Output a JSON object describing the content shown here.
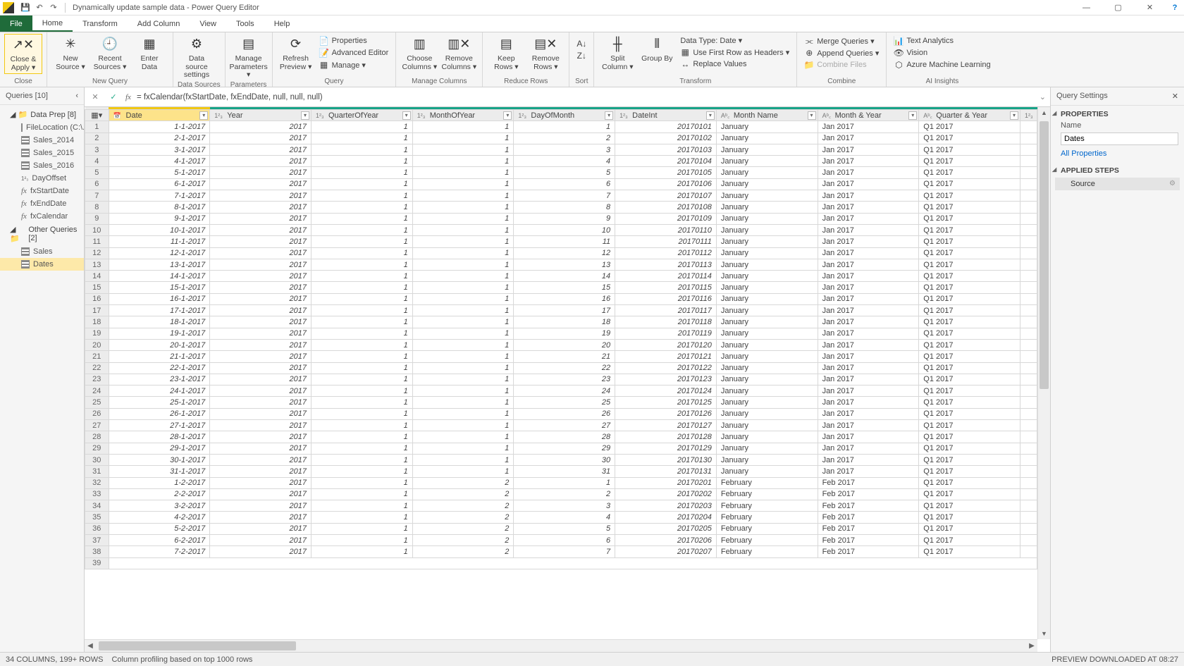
{
  "titlebar": {
    "title": "Dynamically update sample data - Power Query Editor"
  },
  "tabs": {
    "file": "File",
    "home": "Home",
    "transform": "Transform",
    "addcolumn": "Add Column",
    "view": "View",
    "tools": "Tools",
    "help": "Help"
  },
  "ribbon": {
    "close_apply": "Close &\nApply ▾",
    "new_source": "New\nSource ▾",
    "recent_sources": "Recent\nSources ▾",
    "enter_data": "Enter\nData",
    "data_source_settings": "Data source\nsettings",
    "manage_parameters": "Manage\nParameters ▾",
    "refresh_preview": "Refresh\nPreview ▾",
    "properties": "Properties",
    "advanced_editor": "Advanced Editor",
    "manage": "Manage ▾",
    "choose_columns": "Choose\nColumns ▾",
    "remove_columns": "Remove\nColumns ▾",
    "keep_rows": "Keep\nRows ▾",
    "remove_rows": "Remove\nRows ▾",
    "sort": "",
    "split_column": "Split\nColumn ▾",
    "group_by": "Group\nBy",
    "data_type": "Data Type: Date ▾",
    "first_row_headers": "Use First Row as Headers ▾",
    "replace_values": "Replace Values",
    "merge_queries": "Merge Queries ▾",
    "append_queries": "Append Queries ▾",
    "combine_files": "Combine Files",
    "text_analytics": "Text Analytics",
    "vision": "Vision",
    "azure_ml": "Azure Machine Learning",
    "grp_close": "Close",
    "grp_newquery": "New Query",
    "grp_datasources": "Data Sources",
    "grp_parameters": "Parameters",
    "grp_query": "Query",
    "grp_managecols": "Manage Columns",
    "grp_reducerows": "Reduce Rows",
    "grp_sort": "Sort",
    "grp_transform": "Transform",
    "grp_combine": "Combine",
    "grp_ai": "AI Insights"
  },
  "queries": {
    "header": "Queries [10]",
    "group1": "Data Prep [8]",
    "group2": "Other Queries [2]",
    "items1": [
      "FileLocation (C:\\...",
      "Sales_2014",
      "Sales_2015",
      "Sales_2016",
      "DayOffset",
      "fxStartDate",
      "fxEndDate",
      "fxCalendar"
    ],
    "items2": [
      "Sales",
      "Dates"
    ]
  },
  "formula": "= fxCalendar(fxStartDate, fxEndDate, null, null, null)",
  "columns": [
    "Date",
    "Year",
    "QuarterOfYear",
    "MonthOfYear",
    "DayOfMonth",
    "DateInt",
    "Month Name",
    "Month & Year",
    "Quarter & Year"
  ],
  "col_types": [
    "📅",
    "1²₃",
    "1²₃",
    "1²₃",
    "1²₃",
    "1²₃",
    "Aᵇ꜀",
    "Aᵇ꜀",
    "Aᵇ꜀"
  ],
  "rows": [
    [
      "1-1-2017",
      "2017",
      "1",
      "1",
      "1",
      "20170101",
      "January",
      "Jan 2017",
      "Q1 2017"
    ],
    [
      "2-1-2017",
      "2017",
      "1",
      "1",
      "2",
      "20170102",
      "January",
      "Jan 2017",
      "Q1 2017"
    ],
    [
      "3-1-2017",
      "2017",
      "1",
      "1",
      "3",
      "20170103",
      "January",
      "Jan 2017",
      "Q1 2017"
    ],
    [
      "4-1-2017",
      "2017",
      "1",
      "1",
      "4",
      "20170104",
      "January",
      "Jan 2017",
      "Q1 2017"
    ],
    [
      "5-1-2017",
      "2017",
      "1",
      "1",
      "5",
      "20170105",
      "January",
      "Jan 2017",
      "Q1 2017"
    ],
    [
      "6-1-2017",
      "2017",
      "1",
      "1",
      "6",
      "20170106",
      "January",
      "Jan 2017",
      "Q1 2017"
    ],
    [
      "7-1-2017",
      "2017",
      "1",
      "1",
      "7",
      "20170107",
      "January",
      "Jan 2017",
      "Q1 2017"
    ],
    [
      "8-1-2017",
      "2017",
      "1",
      "1",
      "8",
      "20170108",
      "January",
      "Jan 2017",
      "Q1 2017"
    ],
    [
      "9-1-2017",
      "2017",
      "1",
      "1",
      "9",
      "20170109",
      "January",
      "Jan 2017",
      "Q1 2017"
    ],
    [
      "10-1-2017",
      "2017",
      "1",
      "1",
      "10",
      "20170110",
      "January",
      "Jan 2017",
      "Q1 2017"
    ],
    [
      "11-1-2017",
      "2017",
      "1",
      "1",
      "11",
      "20170111",
      "January",
      "Jan 2017",
      "Q1 2017"
    ],
    [
      "12-1-2017",
      "2017",
      "1",
      "1",
      "12",
      "20170112",
      "January",
      "Jan 2017",
      "Q1 2017"
    ],
    [
      "13-1-2017",
      "2017",
      "1",
      "1",
      "13",
      "20170113",
      "January",
      "Jan 2017",
      "Q1 2017"
    ],
    [
      "14-1-2017",
      "2017",
      "1",
      "1",
      "14",
      "20170114",
      "January",
      "Jan 2017",
      "Q1 2017"
    ],
    [
      "15-1-2017",
      "2017",
      "1",
      "1",
      "15",
      "20170115",
      "January",
      "Jan 2017",
      "Q1 2017"
    ],
    [
      "16-1-2017",
      "2017",
      "1",
      "1",
      "16",
      "20170116",
      "January",
      "Jan 2017",
      "Q1 2017"
    ],
    [
      "17-1-2017",
      "2017",
      "1",
      "1",
      "17",
      "20170117",
      "January",
      "Jan 2017",
      "Q1 2017"
    ],
    [
      "18-1-2017",
      "2017",
      "1",
      "1",
      "18",
      "20170118",
      "January",
      "Jan 2017",
      "Q1 2017"
    ],
    [
      "19-1-2017",
      "2017",
      "1",
      "1",
      "19",
      "20170119",
      "January",
      "Jan 2017",
      "Q1 2017"
    ],
    [
      "20-1-2017",
      "2017",
      "1",
      "1",
      "20",
      "20170120",
      "January",
      "Jan 2017",
      "Q1 2017"
    ],
    [
      "21-1-2017",
      "2017",
      "1",
      "1",
      "21",
      "20170121",
      "January",
      "Jan 2017",
      "Q1 2017"
    ],
    [
      "22-1-2017",
      "2017",
      "1",
      "1",
      "22",
      "20170122",
      "January",
      "Jan 2017",
      "Q1 2017"
    ],
    [
      "23-1-2017",
      "2017",
      "1",
      "1",
      "23",
      "20170123",
      "January",
      "Jan 2017",
      "Q1 2017"
    ],
    [
      "24-1-2017",
      "2017",
      "1",
      "1",
      "24",
      "20170124",
      "January",
      "Jan 2017",
      "Q1 2017"
    ],
    [
      "25-1-2017",
      "2017",
      "1",
      "1",
      "25",
      "20170125",
      "January",
      "Jan 2017",
      "Q1 2017"
    ],
    [
      "26-1-2017",
      "2017",
      "1",
      "1",
      "26",
      "20170126",
      "January",
      "Jan 2017",
      "Q1 2017"
    ],
    [
      "27-1-2017",
      "2017",
      "1",
      "1",
      "27",
      "20170127",
      "January",
      "Jan 2017",
      "Q1 2017"
    ],
    [
      "28-1-2017",
      "2017",
      "1",
      "1",
      "28",
      "20170128",
      "January",
      "Jan 2017",
      "Q1 2017"
    ],
    [
      "29-1-2017",
      "2017",
      "1",
      "1",
      "29",
      "20170129",
      "January",
      "Jan 2017",
      "Q1 2017"
    ],
    [
      "30-1-2017",
      "2017",
      "1",
      "1",
      "30",
      "20170130",
      "January",
      "Jan 2017",
      "Q1 2017"
    ],
    [
      "31-1-2017",
      "2017",
      "1",
      "1",
      "31",
      "20170131",
      "January",
      "Jan 2017",
      "Q1 2017"
    ],
    [
      "1-2-2017",
      "2017",
      "1",
      "2",
      "1",
      "20170201",
      "February",
      "Feb 2017",
      "Q1 2017"
    ],
    [
      "2-2-2017",
      "2017",
      "1",
      "2",
      "2",
      "20170202",
      "February",
      "Feb 2017",
      "Q1 2017"
    ],
    [
      "3-2-2017",
      "2017",
      "1",
      "2",
      "3",
      "20170203",
      "February",
      "Feb 2017",
      "Q1 2017"
    ],
    [
      "4-2-2017",
      "2017",
      "1",
      "2",
      "4",
      "20170204",
      "February",
      "Feb 2017",
      "Q1 2017"
    ],
    [
      "5-2-2017",
      "2017",
      "1",
      "2",
      "5",
      "20170205",
      "February",
      "Feb 2017",
      "Q1 2017"
    ],
    [
      "6-2-2017",
      "2017",
      "1",
      "2",
      "6",
      "20170206",
      "February",
      "Feb 2017",
      "Q1 2017"
    ],
    [
      "7-2-2017",
      "2017",
      "1",
      "2",
      "7",
      "20170207",
      "February",
      "Feb 2017",
      "Q1 2017"
    ]
  ],
  "col_align": [
    "num",
    "num",
    "num",
    "num",
    "num",
    "num",
    "txt",
    "txt",
    "txt"
  ],
  "settings": {
    "header": "Query Settings",
    "properties": "PROPERTIES",
    "name_label": "Name",
    "name_value": "Dates",
    "all_properties": "All Properties",
    "applied_steps": "APPLIED STEPS",
    "step1": "Source"
  },
  "status": {
    "left1": "34 COLUMNS, 199+ ROWS",
    "left2": "Column profiling based on top 1000 rows",
    "right": "PREVIEW DOWNLOADED AT 08:27"
  }
}
